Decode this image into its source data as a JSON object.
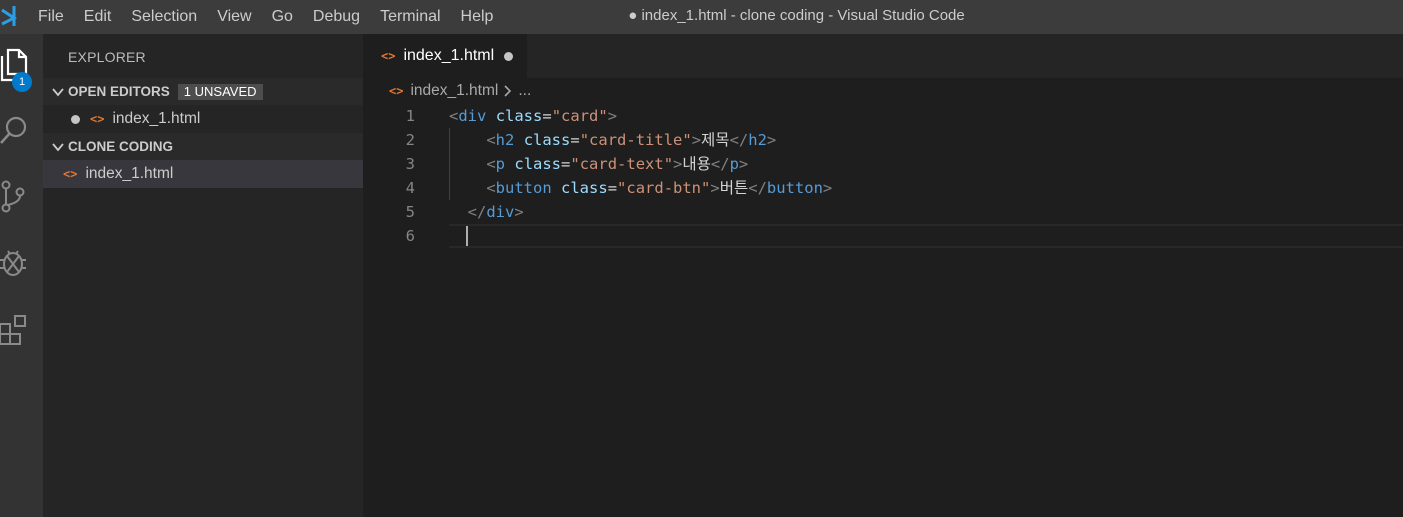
{
  "menu": [
    "File",
    "Edit",
    "Selection",
    "View",
    "Go",
    "Debug",
    "Terminal",
    "Help"
  ],
  "window_title": "● index_1.html - clone coding - Visual Studio Code",
  "activity": {
    "explorer_badge": "1"
  },
  "sidebar": {
    "title": "EXPLORER",
    "open_editors": {
      "label": "OPEN EDITORS",
      "badge": "1 UNSAVED",
      "files": [
        "index_1.html"
      ]
    },
    "folder": {
      "label": "CLONE CODING",
      "files": [
        "index_1.html"
      ]
    }
  },
  "editor": {
    "tab_label": "index_1.html",
    "breadcrumb": {
      "file": "index_1.html",
      "more": "..."
    },
    "line_numbers": [
      "1",
      "2",
      "3",
      "4",
      "5",
      "6"
    ],
    "lines": [
      [
        [
          "<",
          "punc"
        ],
        [
          "div",
          "tag"
        ],
        [
          " ",
          "text"
        ],
        [
          "class",
          "attr"
        ],
        [
          "=",
          "eq"
        ],
        [
          "\"card\"",
          "str"
        ],
        [
          ">",
          "punc"
        ]
      ],
      [
        [
          "    ",
          "text"
        ],
        [
          "<",
          "punc"
        ],
        [
          "h2",
          "tag"
        ],
        [
          " ",
          "text"
        ],
        [
          "class",
          "attr"
        ],
        [
          "=",
          "eq"
        ],
        [
          "\"card-title\"",
          "str"
        ],
        [
          ">",
          "punc"
        ],
        [
          "제목",
          "text"
        ],
        [
          "</",
          "punc"
        ],
        [
          "h2",
          "tag"
        ],
        [
          ">",
          "punc"
        ]
      ],
      [
        [
          "    ",
          "text"
        ],
        [
          "<",
          "punc"
        ],
        [
          "p",
          "tag"
        ],
        [
          " ",
          "text"
        ],
        [
          "class",
          "attr"
        ],
        [
          "=",
          "eq"
        ],
        [
          "\"card-text\"",
          "str"
        ],
        [
          ">",
          "punc"
        ],
        [
          "내용",
          "text"
        ],
        [
          "</",
          "punc"
        ],
        [
          "p",
          "tag"
        ],
        [
          ">",
          "punc"
        ]
      ],
      [
        [
          "    ",
          "text"
        ],
        [
          "<",
          "punc"
        ],
        [
          "button",
          "tag"
        ],
        [
          " ",
          "text"
        ],
        [
          "class",
          "attr"
        ],
        [
          "=",
          "eq"
        ],
        [
          "\"card-btn\"",
          "str"
        ],
        [
          ">",
          "punc"
        ],
        [
          "버튼",
          "text"
        ],
        [
          "</",
          "punc"
        ],
        [
          "button",
          "tag"
        ],
        [
          ">",
          "punc"
        ]
      ],
      [
        [
          "  ",
          "text"
        ],
        [
          "</",
          "punc"
        ],
        [
          "div",
          "tag"
        ],
        [
          ">",
          "punc"
        ]
      ],
      []
    ]
  },
  "colors": {
    "accent": "#007acc",
    "html_icon": "#e37933",
    "tag": "#569cd6",
    "attr": "#9cdcfe",
    "string": "#ce9178"
  }
}
